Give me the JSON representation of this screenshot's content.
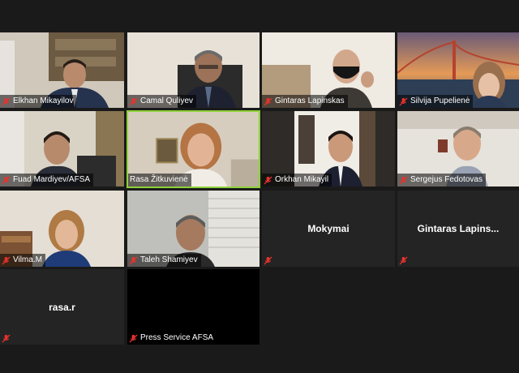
{
  "participants": [
    {
      "name": "Elkhan Mikayilov",
      "muted": true
    },
    {
      "name": "Camal Quliyev",
      "muted": true
    },
    {
      "name": "Gintaras Lapinskas",
      "muted": true
    },
    {
      "name": "Silvija Pupelienė",
      "muted": true
    },
    {
      "name": "Fuad Mardiyev/AFSA",
      "muted": true
    },
    {
      "name": "Rasa Žitkuvienė",
      "muted": false
    },
    {
      "name": "Orkhan Mikayil",
      "muted": true
    },
    {
      "name": "Sergejus Fedotovas",
      "muted": true
    },
    {
      "name": "Vilma.M",
      "muted": true
    },
    {
      "name": "Taleh Shamiyev",
      "muted": true
    },
    {
      "name": "Mokymai",
      "muted": true
    },
    {
      "name": "Gintaras  Lapins...",
      "muted": true
    },
    {
      "name": "rasa.r",
      "muted": true
    },
    {
      "name": "Press Service AFSA",
      "muted": true
    }
  ],
  "colors": {
    "active_speaker_border": "#8ed13a",
    "muted_icon": "#e8322c",
    "background": "#1a1a1a",
    "tile": "#242424"
  },
  "icons": {
    "muted": "mic-muted-icon"
  }
}
